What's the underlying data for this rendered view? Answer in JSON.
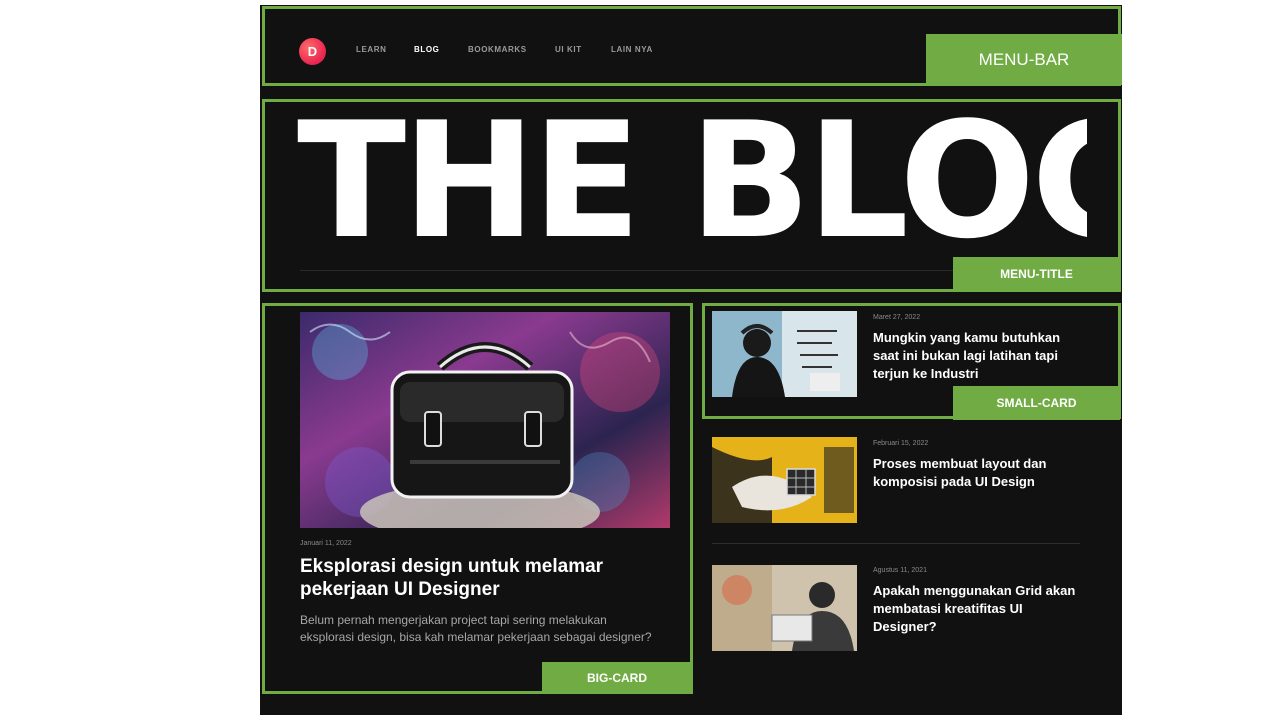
{
  "brand": {
    "logo_letter": "D"
  },
  "nav": {
    "items": [
      "LEARN",
      "BLOG",
      "BOOKMARKS",
      "UI KIT",
      "LAIN NYA"
    ],
    "active_index": 1
  },
  "hero": {
    "title": "THE BLOG"
  },
  "big_card": {
    "date": "Januari 11, 2022",
    "title": "Eksplorasi design untuk melamar pekerjaan UI Designer",
    "description": "Belum pernah mengerjakan project tapi sering melakukan eksplorasi design, bisa kah melamar pekerjaan sebagai designer?"
  },
  "small_cards": [
    {
      "date": "Maret 27, 2022",
      "title": "Mungkin yang kamu butuhkan saat ini bukan lagi latihan tapi terjun ke Industri"
    },
    {
      "date": "Februari 15, 2022",
      "title": "Proses membuat layout dan komposisi pada UI Design"
    },
    {
      "date": "Agustus 11, 2021",
      "title": "Apakah menggunakan Grid akan membatasi kreatifitas UI Designer?"
    }
  ],
  "annotations": {
    "menu_bar": "MENU-BAR",
    "menu_title": "MENU-TITLE",
    "small_card": "SMALL-CARD",
    "big_card": "BIG-CARD"
  },
  "colors": {
    "page_bg": "#111111",
    "annotation_green": "#71ab44",
    "logo_red": "#e8244f",
    "text_primary": "#ffffff",
    "text_muted": "#9a9a9a"
  }
}
